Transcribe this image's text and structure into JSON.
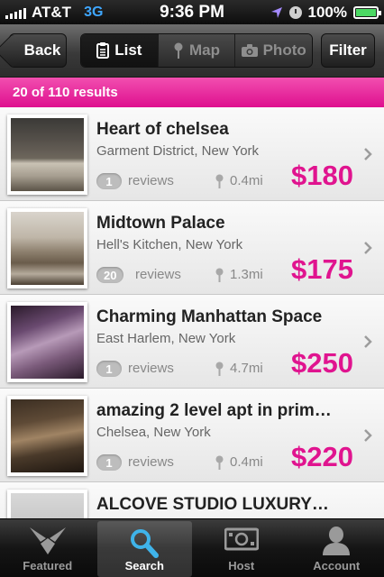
{
  "status_bar": {
    "carrier": "AT&T",
    "network": "3G",
    "time": "9:36 PM",
    "battery": "100%",
    "icons": [
      "signal-icon",
      "location-arrow-icon",
      "alarm-clock-icon",
      "battery-icon"
    ]
  },
  "nav": {
    "back_label": "Back",
    "segments": [
      {
        "label": "List",
        "icon": "list-icon",
        "active": true
      },
      {
        "label": "Map",
        "icon": "map-pin-icon",
        "active": false
      },
      {
        "label": "Photo",
        "icon": "camera-icon",
        "active": false
      }
    ],
    "filter_label": "Filter"
  },
  "results": {
    "text": "20 of 110 results"
  },
  "listings": [
    {
      "title": "Heart of chelsea",
      "location": "Garment District, New York",
      "reviews": "1",
      "reviews_label": "reviews",
      "distance": "0.4mi",
      "price": "$180"
    },
    {
      "title": "Midtown Palace",
      "location": "Hell's Kitchen, New York",
      "reviews": "20",
      "reviews_label": "reviews",
      "distance": "1.3mi",
      "price": "$175"
    },
    {
      "title": "Charming Manhattan Space",
      "location": "East Harlem, New York",
      "reviews": "1",
      "reviews_label": "reviews",
      "distance": "4.7mi",
      "price": "$250"
    },
    {
      "title": "amazing 2 level apt in prim…",
      "location": "Chelsea, New York",
      "reviews": "1",
      "reviews_label": "reviews",
      "distance": "0.4mi",
      "price": "$220"
    },
    {
      "title": "ALCOVE STUDIO LUXURY…",
      "location": "",
      "reviews": "",
      "reviews_label": "",
      "distance": "",
      "price": ""
    }
  ],
  "tabs": [
    {
      "label": "Featured",
      "icon": "featured-icon",
      "active": false
    },
    {
      "label": "Search",
      "icon": "search-icon",
      "active": true
    },
    {
      "label": "Host",
      "icon": "money-icon",
      "active": false
    },
    {
      "label": "Account",
      "icon": "person-icon",
      "active": false
    }
  ],
  "colors": {
    "accent": "#e0148f",
    "results_bar": "#e8258f"
  }
}
